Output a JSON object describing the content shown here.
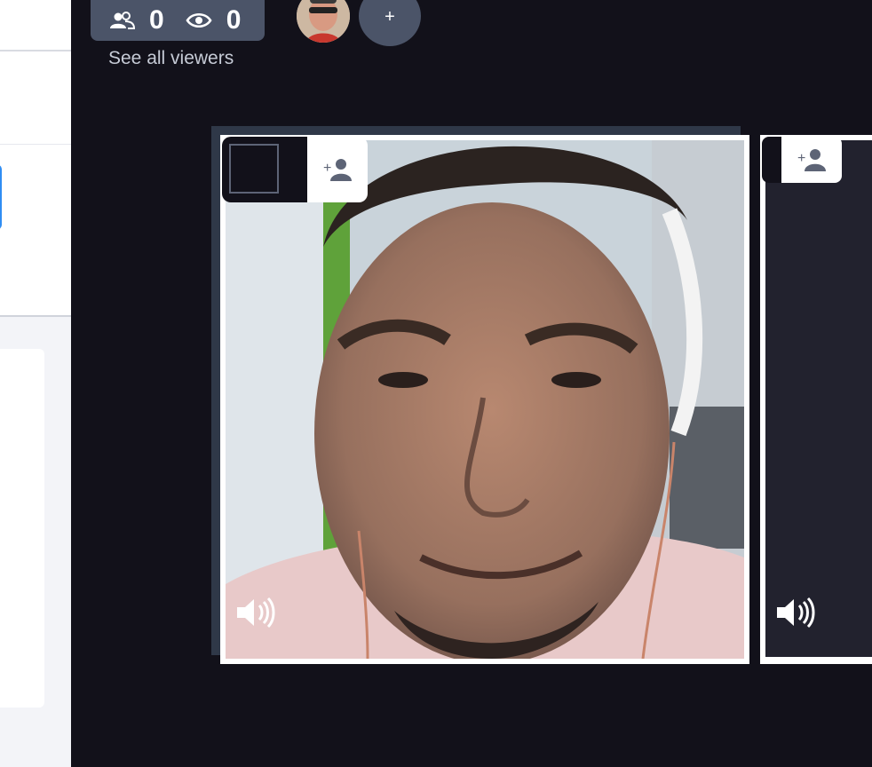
{
  "viewers_bar": {
    "participants_icon": "participants-icon",
    "participants_count": "0",
    "views_icon": "eye-icon",
    "views_count": "0",
    "see_all_label": "See all viewers",
    "add_label": "+"
  },
  "tiles": [
    {
      "has_video": true,
      "add_icon": "add-user-icon",
      "audio_icon": "speaker-icon"
    },
    {
      "has_video": false,
      "add_icon": "add-user-icon",
      "audio_icon": "speaker-icon"
    }
  ],
  "colors": {
    "background": "#12111a",
    "pill": "#4b5468",
    "frame": "#ffffff",
    "accent_blue": "#2f8df3"
  }
}
